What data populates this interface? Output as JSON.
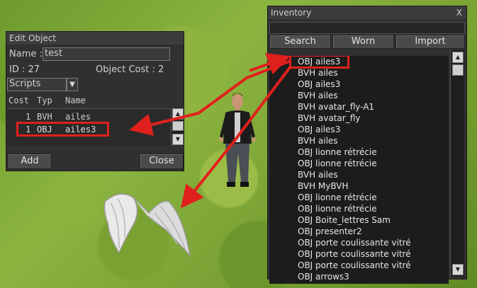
{
  "edit_object": {
    "title": "Edit Object",
    "name_label": "Name :",
    "name_value": "test",
    "id_label": "ID : 27",
    "object_cost_label": "Object Cost : 2",
    "dropdown_value": "Scripts",
    "columns": [
      "Cost",
      "Typ",
      "Name"
    ],
    "rows": [
      {
        "cost": "1",
        "typ": "BVH",
        "name": "ailes"
      },
      {
        "cost": "1",
        "typ": "OBJ",
        "name": "ailes3"
      }
    ],
    "add_label": "Add",
    "close_label": "Close"
  },
  "inventory": {
    "title": "Inventory",
    "close_glyph": "X",
    "tabs": [
      "Search",
      "Worn",
      "Import"
    ],
    "items": [
      "OBJ ailes3",
      "BVH ailes",
      "OBJ ailes3",
      "BVH ailes",
      "BVH avatar_fly-A1",
      "BVH avatar_fly",
      "OBJ ailes3",
      "BVH ailes",
      "OBJ lionne rétrécie",
      "OBJ lionne rétrécie",
      "BVH ailes",
      "BVH MyBVH",
      "OBJ lionne rétrécie",
      "OBJ lionne rétrécie",
      "OBJ Boite_lettres Sam",
      "OBJ presenter2",
      "OBJ porte coulissante vitré",
      "OBJ porte coulissante vitré",
      "OBJ porte coulissante vitré",
      "OBJ arrows3"
    ]
  },
  "colors": {
    "highlight": "#e0201c",
    "panel": "#303030"
  }
}
